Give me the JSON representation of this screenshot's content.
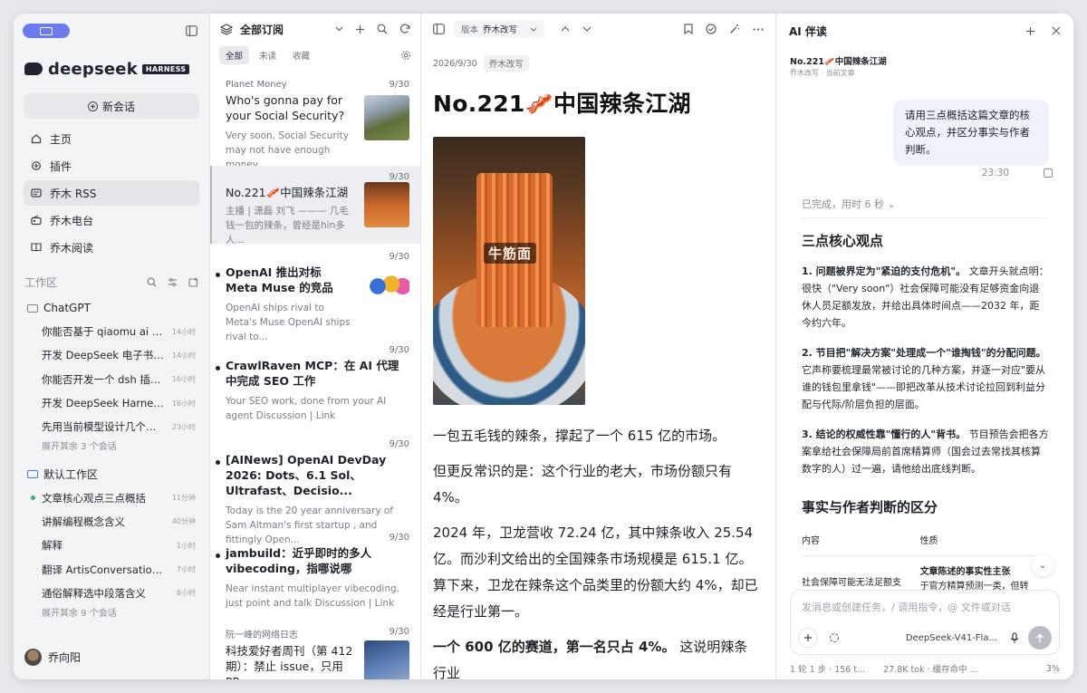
{
  "sidebar": {
    "brand_name": "deepseek",
    "brand_tag": "HARNESS",
    "new_chat": "新会话",
    "nav": [
      {
        "label": "主页",
        "icon": "home-icon"
      },
      {
        "label": "插件",
        "icon": "plugin-icon"
      },
      {
        "label": "乔木 RSS",
        "icon": "rss-icon"
      },
      {
        "label": "乔木电台",
        "icon": "radio-icon"
      },
      {
        "label": "乔木阅读",
        "icon": "book-icon"
      }
    ],
    "workspace_label": "工作区",
    "folders": [
      {
        "name": "ChatGPT",
        "items": [
          {
            "title": "你能否基于 qiaomu ai rss ...",
            "time": "14小时"
          },
          {
            "title": "开发 DeepSeek 电子书阅...",
            "time": "14小时"
          },
          {
            "title": "你能否开发一个 dsh 插件...",
            "time": "16小时"
          },
          {
            "title": "开发 DeepSeek Harness ...",
            "time": "16小时"
          },
          {
            "title": "先用当前模型设计几个好...",
            "time": "23小时"
          }
        ],
        "expand": "展开其余 3 个会话"
      },
      {
        "name": "默认工作区",
        "items": [
          {
            "title": "文章核心观点三点概括",
            "time": "11分钟"
          },
          {
            "title": "讲解编程概念含义",
            "time": "40分钟"
          },
          {
            "title": "解释",
            "time": "1小时"
          },
          {
            "title": "翻译 ArtisConversations 选...",
            "time": "7小时"
          },
          {
            "title": "通俗解释选中段落含义",
            "time": "8小时"
          }
        ],
        "expand": "展开其余 9 个会话"
      }
    ],
    "user_name": "乔向阳"
  },
  "feed": {
    "title": "全部订阅",
    "tabs": [
      "全部",
      "未读",
      "收藏"
    ],
    "articles": [
      {
        "source": "Planet Money",
        "date": "9/30",
        "title": "Who's gonna pay for your Social Security?",
        "summary": "Very soon, Social Security may not have enough money..."
      },
      {
        "source": "",
        "date": "9/30",
        "title": "No.221🥓中国辣条江湖",
        "summary": "主播 | 潇磊 刘飞 ——— 几毛钱一包的辣条，曾经是hin多人..."
      },
      {
        "source": "",
        "date": "9/30",
        "title": "OpenAI 推出对标 Meta Muse 的竞品",
        "summary": "OpenAI ships rival to Meta's Muse OpenAI ships rival to..."
      },
      {
        "source": "",
        "date": "9/30",
        "title": "CrawlRaven MCP：在 AI 代理中完成 SEO 工作",
        "summary": "Your SEO work, done from your AI agent Discussion | Link"
      },
      {
        "source": "",
        "date": "9/30",
        "title": "[AINews] OpenAI DevDay 2026: Dots、6.1 Sol、Ultrafast、Decisio...",
        "summary": "Today is the 20 year anniversary of Sam Altman's first startup , and fittingly Open..."
      },
      {
        "source": "",
        "date": "9/30",
        "title": "jambuild：近乎即时的多人 vibecoding，指哪说哪",
        "summary": "Near instant multiplayer vibecoding, just point and talk Discussion | Link"
      },
      {
        "source": "阮一峰的网络日志",
        "date": "9/30",
        "title": "科技爱好者周刊（第 412 期）：禁止 issue，只用 PR",
        "summary": ""
      }
    ]
  },
  "reader": {
    "version_label": "版本",
    "version_value": "乔木改写",
    "date": "2026/9/30",
    "chip": "乔木改写",
    "title": "No.221🥓中国辣条江湖",
    "image_caption": "牛筋面",
    "p1": "一包五毛钱的辣条，撑起了一个 615 亿的市场。",
    "p2": "但更反常识的是：这个行业的老大，市场份额只有 4%。",
    "p3": "2024 年，卫龙营收 72.24 亿，其中辣条收入 25.54 亿。而沙利文给出的全国辣条市场规模是 615.1 亿。算下来，卫龙在辣条这个品类里的份额大约 4%，却已经是行业第一。",
    "p4_bold": "一个 600 亿的赛道，第一名只占 4%。",
    "p4_rest": "这说明辣条行业"
  },
  "ai": {
    "title": "AI 伴读",
    "ctx_title": "No.221🥓中国辣条江湖",
    "ctx_sub": "乔木改写 · 当前文章",
    "user_msg": "请用三点概括这篇文章的核心观点，并区分事实与作者判断。",
    "msg_time": "23:30",
    "done": "已完成，用时 6 秒",
    "h1": "三点核心观点",
    "pt1_bold": "1. 问题被界定为\"紧迫的支付危机\"。",
    "pt1": "文章开头就点明：很快（\"Very soon\"）社会保障可能没有足够资金向退休人员足额发放，并给出具体时间点——2032 年，距今约六年。",
    "pt2_bold": "2. 节目把\"解决方案\"处理成一个\"谁掏钱\"的分配问题。",
    "pt2": "它声称要梳理最常被讨论的几种方案，并逐一对应\"要从谁的钱包里拿钱\"——即把改革从技术讨论拉回到利益分配与代际/阶层负担的层面。",
    "pt3_bold": "3. 结论的权威性靠\"懂行的人\"背书。",
    "pt3": "节目预告会把各方案拿给社会保障局前首席精算师（国会过去常找其核算数字的人）过一遍，请他给出底线判断。",
    "h2": "事实与作者判断的区分",
    "table_headers": [
      "内容",
      "性质"
    ],
    "table_row": [
      "社会保障可能无法足额支",
      "文章陈述的事实性主张",
      "于官方精算预测一类，但转"
    ],
    "composer_placeholder": "发消息或创建任务，/ 调用指令，@ 文件或对话",
    "model": "DeepSeek-V41-Fla...",
    "status_left": "1 轮 1 步 · 156 t...",
    "status_mid": "27.8K tok · 缓存命中 ...",
    "status_right": "3%"
  }
}
